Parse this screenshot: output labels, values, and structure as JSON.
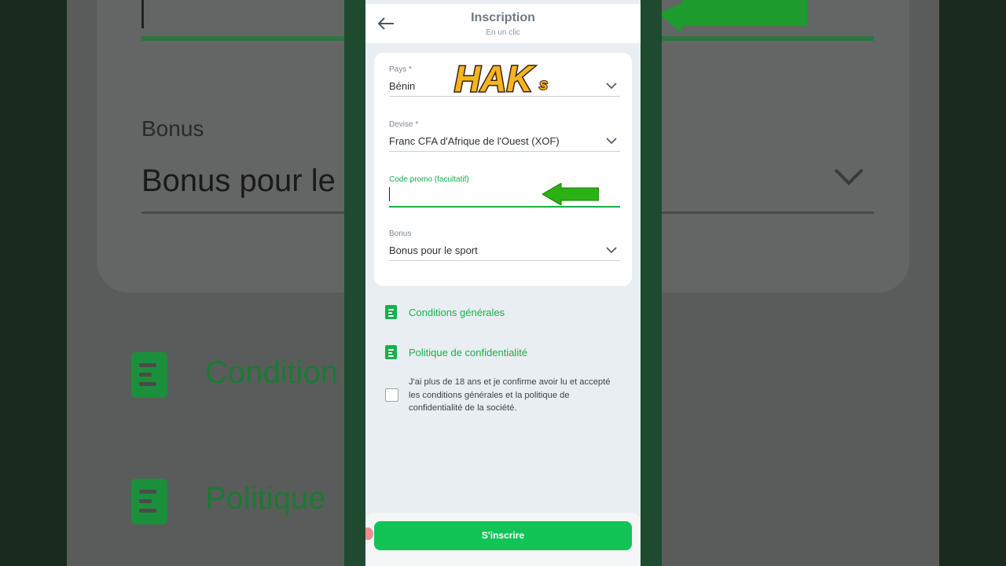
{
  "header": {
    "title": "Inscription",
    "subtitle": "En un clic"
  },
  "form": {
    "country": {
      "label": "Pays *",
      "value": "Bénin"
    },
    "currency": {
      "label": "Devise *",
      "value": "Franc CFA d'Afrique de l'Ouest (XOF)"
    },
    "promo": {
      "label": "Code promo (facultatif)",
      "value": ""
    },
    "bonus": {
      "label": "Bonus",
      "value": "Bonus pour le sport"
    }
  },
  "links": {
    "terms": "Conditions générales",
    "privacy": "Politique de confidentialité"
  },
  "consent": {
    "checked": false,
    "text": "J'ai plus de 18 ans et je confirme avoir lu et accepté les conditions générales et la politique de confidentialité de la société."
  },
  "submit_label": "S'inscrire",
  "overlay": {
    "logo_text": "HAKs"
  },
  "background": {
    "bonus_label": "Bonus",
    "bonus_value": "Bonus pour le",
    "conditions_text": "Condition",
    "politique_text": "Politique"
  },
  "colors": {
    "accent": "#17b04a",
    "button": "#12c356",
    "card": "#ffffff",
    "page": "#e9eef2",
    "frame": "#1e4a30"
  },
  "icons": {
    "back": "arrow-left-icon",
    "dropdown": "chevron-down-icon",
    "document": "document-icon",
    "pointer": "green-arrow-icon"
  }
}
